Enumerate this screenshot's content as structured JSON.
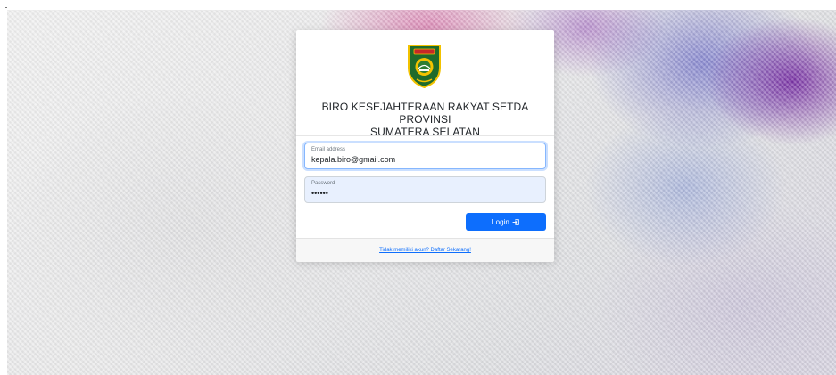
{
  "header": {
    "org_line1": "BIRO KESEJAHTERAAN RAKYAT SETDA PROVINSI",
    "org_line2": "SUMATERA SELATAN"
  },
  "logo": {
    "icon": "provincial-emblem-icon",
    "colors": [
      "#1f6b2b",
      "#f2c200",
      "#c62828"
    ]
  },
  "form": {
    "email": {
      "label": "Email address",
      "value": "kepala.biro@gmail.com"
    },
    "password": {
      "label": "Password",
      "value": "••••••"
    },
    "login_label": "Login",
    "login_icon": "sign-in-icon"
  },
  "footer": {
    "register_link": "Tidak memiliki akun? Daftar Sekarang!"
  },
  "colors": {
    "primary": "#0d6efd",
    "focus_border": "#86b7fe",
    "autofill_bg": "#e8f0fe"
  }
}
